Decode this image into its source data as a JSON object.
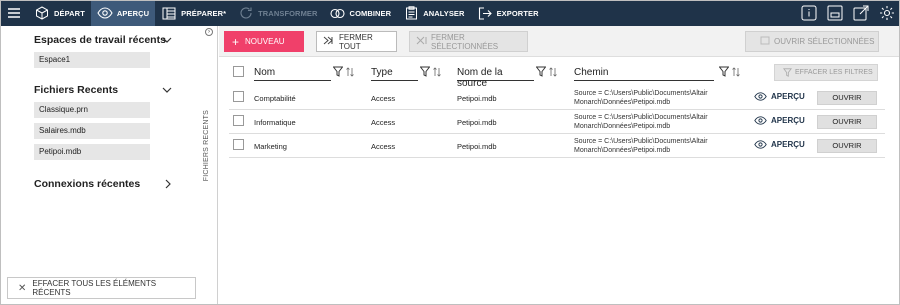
{
  "nav": {
    "menu_icon": "hamburger-icon",
    "items": [
      {
        "label": "DÉPART",
        "icon": "cube-icon",
        "active": false,
        "disabled": false
      },
      {
        "label": "APERÇU",
        "icon": "eye-icon",
        "active": true,
        "disabled": false
      },
      {
        "label": "PRÉPARER*",
        "icon": "table-icon",
        "active": false,
        "disabled": false
      },
      {
        "label": "TRANSFORMER",
        "icon": "refresh-icon",
        "active": false,
        "disabled": true
      },
      {
        "label": "COMBINER",
        "icon": "combine-icon",
        "active": false,
        "disabled": false
      },
      {
        "label": "ANALYSER",
        "icon": "clipboard-icon",
        "active": false,
        "disabled": false
      },
      {
        "label": "EXPORTER",
        "icon": "export-icon",
        "active": false,
        "disabled": false
      }
    ],
    "right_icons": [
      "info-icon",
      "window-icon",
      "external-icon",
      "gear-icon"
    ]
  },
  "sidebar": {
    "workspaces_title": "Espaces de travail récents",
    "workspaces": [
      "Espace1"
    ],
    "files_title": "Fichiers Recents",
    "files": [
      "Classique.prn",
      "Salaires.mdb",
      "Petipoi.mdb"
    ],
    "connections_title": "Connexions récentes",
    "clear_all_label": "EFFACER TOUS LES ÉLÉMENTS RÉCENTS",
    "vertical_label": "FICHIERS RECENTS"
  },
  "toolbar": {
    "new_label": "NOUVEAU",
    "close_all_label": "FERMER TOUT",
    "close_selected_label": "FERMER SÉLECTIONNÉES",
    "open_selected_label": "OUVRIR SÉLECTIONNÉES"
  },
  "table": {
    "columns": {
      "name": "Nom",
      "type": "Type",
      "source": "Nom de la source",
      "path": "Chemin"
    },
    "clear_filters_label": "EFFACER LES FILTRES",
    "preview_label": "APERÇU",
    "open_label": "OUVRIR",
    "rows": [
      {
        "name": "Comptabilité",
        "type": "Access",
        "source": "Petipoi.mdb",
        "path_line1": "Source = C:\\Users\\Public\\Documents\\Altair",
        "path_line2": "Monarch\\Données\\Petipoi.mdb"
      },
      {
        "name": "Informatique",
        "type": "Access",
        "source": "Petipoi.mdb",
        "path_line1": "Source = C:\\Users\\Public\\Documents\\Altair",
        "path_line2": "Monarch\\Données\\Petipoi.mdb"
      },
      {
        "name": "Marketing",
        "type": "Access",
        "source": "Petipoi.mdb",
        "path_line1": "Source = C:\\Users\\Public\\Documents\\Altair",
        "path_line2": "Monarch\\Données\\Petipoi.mdb"
      }
    ]
  },
  "colors": {
    "topbar": "#1f3349",
    "accent": "#f0406a",
    "active_tab": "#3e5a7a"
  }
}
